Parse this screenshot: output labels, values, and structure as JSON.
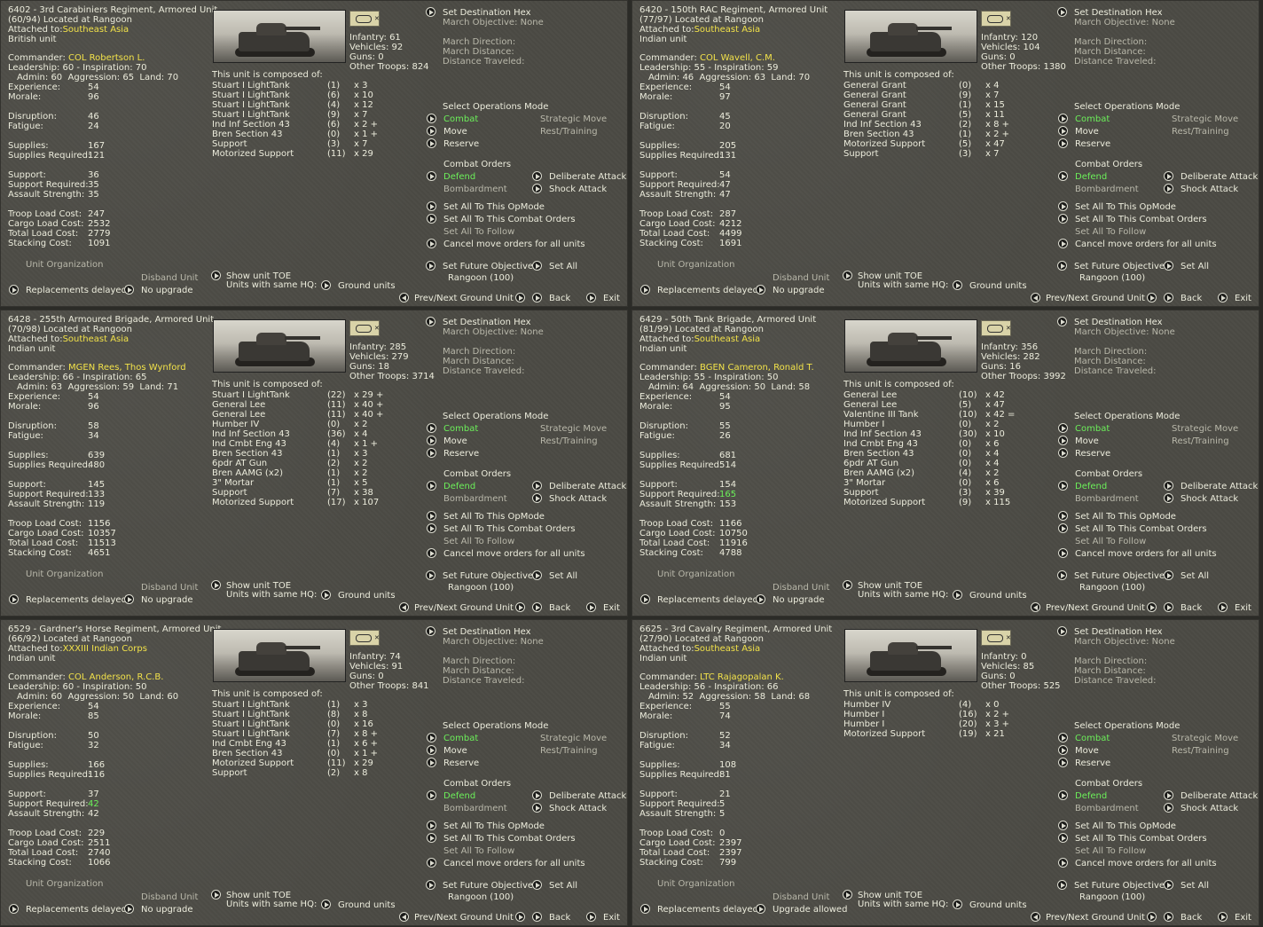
{
  "labels": {
    "located_at": "Located at",
    "attached_to": "Attached to:",
    "commander": "Commander:",
    "admin": "Admin:",
    "aggression": "Aggression:",
    "land": "Land:",
    "experience": "Experience:",
    "morale": "Morale:",
    "disruption": "Disruption:",
    "fatigue": "Fatigue:",
    "supplies": "Supplies:",
    "supplies_required": "Supplies Required:",
    "support": "Support:",
    "support_required": "Support Required:",
    "assault_strength": "Assault Strength:",
    "troop_load": "Troop Load Cost:",
    "cargo_load": "Cargo Load Cost:",
    "total_load": "Total Load Cost:",
    "stacking": "Stacking Cost:",
    "unit_org": "Unit Organization",
    "disband": "Disband Unit",
    "replacements": "Replacements delayed",
    "infantry": "Infantry:",
    "vehicles": "Vehicles:",
    "guns": "Guns:",
    "other_troops": "Other Troops:",
    "composed_of": "This unit is composed of:",
    "show_toe": "Show unit TOE",
    "same_hq": "Units with same HQ:",
    "ground_units": "Ground units",
    "set_dest": "Set Destination Hex",
    "march_obj": "March Objective: None",
    "march_dir": "March Direction:",
    "march_dist": "March Distance:",
    "dist_trav": "Distance Traveled:",
    "select_ops": "Select Operations Mode",
    "combat": "Combat",
    "strategic_move": "Strategic Move",
    "move": "Move",
    "rest": "Rest/Training",
    "reserve": "Reserve",
    "combat_orders": "Combat Orders",
    "defend": "Defend",
    "deliberate": "Deliberate Attack",
    "bombardment": "Bombardment",
    "shock": "Shock Attack",
    "set_all_opmode": "Set All To This OpMode",
    "set_all_combat": "Set All To This Combat Orders",
    "set_all_follow": "Set All To Follow",
    "cancel_move": "Cancel move orders for all units",
    "set_future": "Set Future Objective",
    "set_all": "Set All",
    "prev_next": "Prev/Next Ground Unit",
    "back": "Back",
    "exit": "Exit"
  },
  "panels": [
    {
      "title": "6402 - 3rd Carabiniers Regiment, Armored Unit",
      "strength": "(60/94)",
      "location": "Rangoon",
      "attached": "Southeast Asia",
      "nationality": "British unit",
      "commander": "COL Robertson L.",
      "leadership_line": "Leadership: 60 - Inspiration: 70",
      "admin": "60",
      "aggression": "65",
      "land": "70",
      "experience": "54",
      "morale": "96",
      "disruption": "46",
      "fatigue": "24",
      "supplies": "167",
      "supplies_required": "121",
      "support": "36",
      "support_required": "35",
      "support_required_green": false,
      "assault": "35",
      "troop_load": "247",
      "cargo_load": "2532",
      "total_load": "2779",
      "stacking": "1091",
      "upgrade": "No upgrade",
      "infantry": "61",
      "vehicles": "92",
      "guns": "0",
      "other_troops": "824",
      "toe": [
        [
          "Stuart I LightTank",
          "(1)",
          "x 3"
        ],
        [
          "Stuart I LightTank",
          "(6)",
          "x 10"
        ],
        [
          "Stuart I LightTank",
          "(4)",
          "x 12"
        ],
        [
          "Stuart I LightTank",
          "(9)",
          "x 7"
        ],
        [
          "Ind Inf Section 43",
          "(6)",
          "x 2 +"
        ],
        [
          "Bren Section 43",
          "(0)",
          "x 1 +"
        ],
        [
          "Support",
          "(3)",
          "x 7"
        ],
        [
          "Motorized Support",
          "(11)",
          "x 29"
        ]
      ],
      "future_obj": "Rangoon (100)"
    },
    {
      "title": "6420 - 150th RAC Regiment, Armored Unit",
      "strength": "(77/97)",
      "location": "Rangoon",
      "attached": "Southeast Asia",
      "nationality": "Indian unit",
      "commander": "COL Wavell, C.M.",
      "leadership_line": "Leadership: 55 - Inspiration: 59",
      "admin": "46",
      "aggression": "63",
      "land": "70",
      "experience": "54",
      "morale": "97",
      "disruption": "45",
      "fatigue": "20",
      "supplies": "205",
      "supplies_required": "131",
      "support": "54",
      "support_required": "47",
      "support_required_green": false,
      "assault": "47",
      "troop_load": "287",
      "cargo_load": "4212",
      "total_load": "4499",
      "stacking": "1691",
      "upgrade": "No upgrade",
      "infantry": "120",
      "vehicles": "104",
      "guns": "0",
      "other_troops": "1380",
      "toe": [
        [
          "General Grant",
          "(0)",
          "x 4"
        ],
        [
          "General Grant",
          "(9)",
          "x 7"
        ],
        [
          "General Grant",
          "(1)",
          "x 15"
        ],
        [
          "General Grant",
          "(5)",
          "x 11"
        ],
        [
          "Ind Inf Section 43",
          "(2)",
          "x 8 +"
        ],
        [
          "Bren Section 43",
          "(1)",
          "x 2 +"
        ],
        [
          "Motorized Support",
          "(5)",
          "x 47"
        ],
        [
          "Support",
          "(3)",
          "x 7"
        ]
      ],
      "future_obj": "Rangoon (100)"
    },
    {
      "title": "6428 - 255th Armoured Brigade, Armored Unit",
      "strength": "(70/98)",
      "location": "Rangoon",
      "attached": "Southeast Asia",
      "nationality": "Indian unit",
      "commander": "MGEN Rees, Thos Wynford",
      "leadership_line": "Leadership: 66 - Inspiration: 65",
      "admin": "63",
      "aggression": "59",
      "land": "71",
      "experience": "54",
      "morale": "96",
      "disruption": "58",
      "fatigue": "34",
      "supplies": "639",
      "supplies_required": "480",
      "support": "145",
      "support_required": "133",
      "support_required_green": false,
      "assault": "119",
      "troop_load": "1156",
      "cargo_load": "10357",
      "total_load": "11513",
      "stacking": "4651",
      "upgrade": "No upgrade",
      "infantry": "285",
      "vehicles": "279",
      "guns": "18",
      "other_troops": "3714",
      "toe": [
        [
          "Stuart I LightTank",
          "(22)",
          "x 29 +"
        ],
        [
          "General Lee",
          "(11)",
          "x 40 +"
        ],
        [
          "General Lee",
          "(11)",
          "x 40 +"
        ],
        [
          "Humber IV",
          "(0)",
          "x 2"
        ],
        [
          "Ind Inf Section 43",
          "(36)",
          "x 4"
        ],
        [
          "Ind Cmbt Eng 43",
          "(4)",
          "x 1 +"
        ],
        [
          "Bren Section 43",
          "(1)",
          "x 3"
        ],
        [
          "6pdr AT Gun",
          "(2)",
          "x 2"
        ],
        [
          "Bren AAMG (x2)",
          "(1)",
          "x 2"
        ],
        [
          "3\" Mortar",
          "(1)",
          "x 5"
        ],
        [
          "Support",
          "(7)",
          "x 38"
        ],
        [
          "Motorized Support",
          "(17)",
          "x 107"
        ]
      ],
      "future_obj": "Rangoon (100)"
    },
    {
      "title": "6429 - 50th Tank Brigade, Armored Unit",
      "strength": "(81/99)",
      "location": "Rangoon",
      "attached": "Southeast Asia",
      "nationality": "Indian unit",
      "commander": "BGEN Cameron, Ronald T.",
      "leadership_line": "Leadership: 55 - Inspiration: 50",
      "admin": "64",
      "aggression": "50",
      "land": "58",
      "experience": "54",
      "morale": "95",
      "disruption": "55",
      "fatigue": "26",
      "supplies": "681",
      "supplies_required": "514",
      "support": "154",
      "support_required": "165",
      "support_required_green": true,
      "assault": "153",
      "troop_load": "1166",
      "cargo_load": "10750",
      "total_load": "11916",
      "stacking": "4788",
      "upgrade": "No upgrade",
      "infantry": "356",
      "vehicles": "282",
      "guns": "16",
      "other_troops": "3992",
      "toe": [
        [
          "General Lee",
          "(10)",
          "x 42"
        ],
        [
          "General Lee",
          "(5)",
          "x 47"
        ],
        [
          "Valentine III Tank",
          "(10)",
          "x 42 ="
        ],
        [
          "Humber I",
          "(0)",
          "x 2"
        ],
        [
          "Ind Inf Section 43",
          "(30)",
          "x 10"
        ],
        [
          "Ind Cmbt Eng 43",
          "(0)",
          "x 6"
        ],
        [
          "Bren Section 43",
          "(0)",
          "x 4"
        ],
        [
          "6pdr AT Gun",
          "(0)",
          "x 4"
        ],
        [
          "Bren AAMG (x2)",
          "(4)",
          "x 2"
        ],
        [
          "3\" Mortar",
          "(0)",
          "x 6"
        ],
        [
          "Support",
          "(3)",
          "x 39"
        ],
        [
          "Motorized Support",
          "(9)",
          "x 115"
        ]
      ],
      "future_obj": "Rangoon (100)"
    },
    {
      "title": "6529 - Gardner's Horse Regiment, Armored Unit",
      "strength": "(66/92)",
      "location": "Rangoon",
      "attached": "XXXIII Indian Corps",
      "nationality": "Indian unit",
      "commander": "COL Anderson, R.C.B.",
      "leadership_line": "Leadership: 60 - Inspiration: 50",
      "admin": "60",
      "aggression": "50",
      "land": "60",
      "experience": "54",
      "morale": "85",
      "disruption": "50",
      "fatigue": "32",
      "supplies": "166",
      "supplies_required": "116",
      "support": "37",
      "support_required": "42",
      "support_required_green": true,
      "assault": "42",
      "troop_load": "229",
      "cargo_load": "2511",
      "total_load": "2740",
      "stacking": "1066",
      "upgrade": "No upgrade",
      "infantry": "74",
      "vehicles": "91",
      "guns": "0",
      "other_troops": "841",
      "toe": [
        [
          "Stuart I LightTank",
          "(1)",
          "x 3"
        ],
        [
          "Stuart I LightTank",
          "(8)",
          "x 8"
        ],
        [
          "Stuart I LightTank",
          "(0)",
          "x 16"
        ],
        [
          "Stuart I LightTank",
          "(7)",
          "x 8 +"
        ],
        [
          "Ind Cmbt Eng 43",
          "(1)",
          "x 6 +"
        ],
        [
          "Bren Section 43",
          "(0)",
          "x 1 +"
        ],
        [
          "Motorized Support",
          "(11)",
          "x 29"
        ],
        [
          "Support",
          "(2)",
          "x 8"
        ]
      ],
      "future_obj": "Rangoon (100)"
    },
    {
      "title": "6625 - 3rd Cavalry Regiment, Armored Unit",
      "strength": "(27/90)",
      "location": "Rangoon",
      "attached": "Southeast Asia",
      "nationality": "Indian unit",
      "commander": "LTC Rajagopalan K.",
      "leadership_line": "Leadership: 56 - Inspiration: 66",
      "admin": "52",
      "aggression": "58",
      "land": "68",
      "experience": "55",
      "morale": "74",
      "disruption": "52",
      "fatigue": "34",
      "supplies": "108",
      "supplies_required": "81",
      "support": "21",
      "support_required": "5",
      "support_required_green": false,
      "assault": "5",
      "troop_load": "0",
      "cargo_load": "2397",
      "total_load": "2397",
      "stacking": "799",
      "upgrade": "Upgrade allowed",
      "infantry": "0",
      "vehicles": "85",
      "guns": "0",
      "other_troops": "525",
      "toe": [
        [
          "Humber IV",
          "(4)",
          "x 0"
        ],
        [
          "Humber I",
          "(16)",
          "x 2 +"
        ],
        [
          "Humber I",
          "(20)",
          "x 3 +"
        ],
        [
          "Motorized Support",
          "(19)",
          "x 21"
        ]
      ],
      "future_obj": "Rangoon (100)"
    }
  ]
}
